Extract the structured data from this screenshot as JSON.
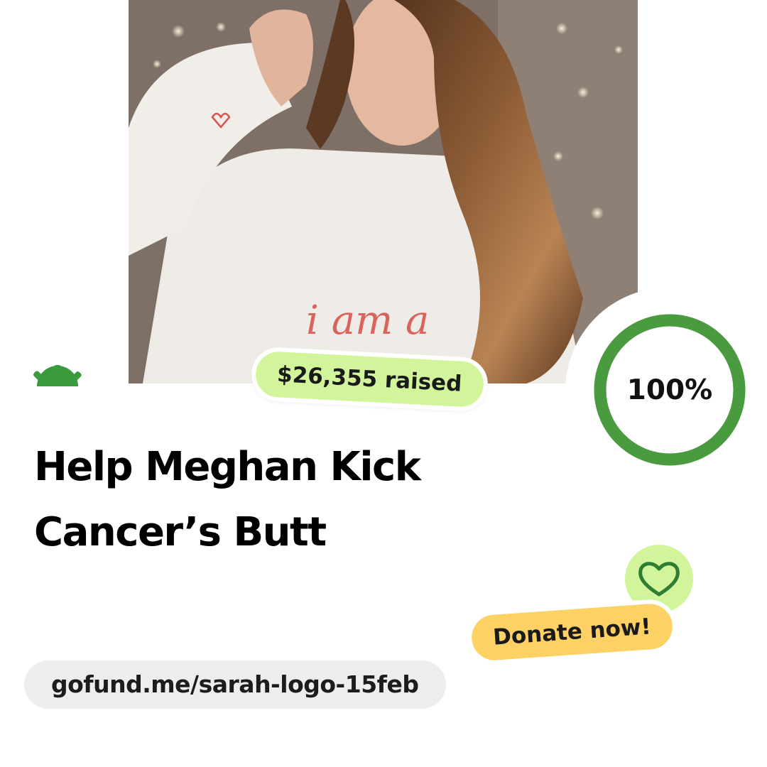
{
  "photo": {
    "icon": "campaign-photo",
    "alt_subject": "woman-in-white-sweatshirt"
  },
  "logo": {
    "icon": "gofundme-sunrise-logo-icon",
    "color": "#3a9a3e"
  },
  "raised": {
    "label": "$26,355 raised",
    "color": "#d2f59b"
  },
  "progress": {
    "percent_label": "100%",
    "value": 1.0,
    "ring_color": "#4a9a3f"
  },
  "campaign": {
    "title_line1": "Help Meghan Kick",
    "title_line2": "Cancer’s Butt"
  },
  "donate": {
    "label": "Donate now!",
    "color": "#fdd163",
    "heart_icon": "heart-icon",
    "heart_badge_color": "#d2f59b"
  },
  "link": {
    "url": "gofund.me/sarah-logo-15feb",
    "pill_color": "#ededed"
  }
}
